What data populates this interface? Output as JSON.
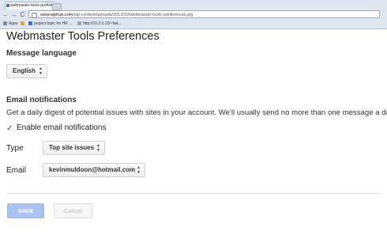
{
  "browser": {
    "tab_title": "webmaster-tools-prefere",
    "tab_close": "×",
    "back": "←",
    "forward": "→",
    "reload": "C",
    "url_domain": "www.wphub.com",
    "url_path": "/wp-content/uploads/2013/10/webmaster-tools-preferences.jpg",
    "bookmarks": [
      {
        "label": "Apps",
        "color": "#7d8da3"
      },
      {
        "label": "",
        "color": "#e6a23c"
      },
      {
        "label": "project topic for HR ...",
        "color": "#3e6fc2"
      },
      {
        "label": "http://10.2.0.10/~fait...",
        "color": "#9aa6b5"
      }
    ]
  },
  "page": {
    "title": "Webmaster Tools Preferences",
    "message_language_heading": "Message language",
    "language_value": "English",
    "email_notifications_heading": "Email notifications",
    "description": "Get a daily digest of potential issues with sites in your account. We'll usually send no more than one message a day.",
    "checkbox_mark": "✓",
    "enable_label": "Enable email notifications",
    "enable_checked": true,
    "type_label": "Type",
    "type_value": "Top site issues",
    "email_label": "Email",
    "email_value": "kevinmuldoon@hotmail.com",
    "select_arrows": "▲\n▼",
    "save_label": "SAVE",
    "cancel_label": "Cancel"
  }
}
